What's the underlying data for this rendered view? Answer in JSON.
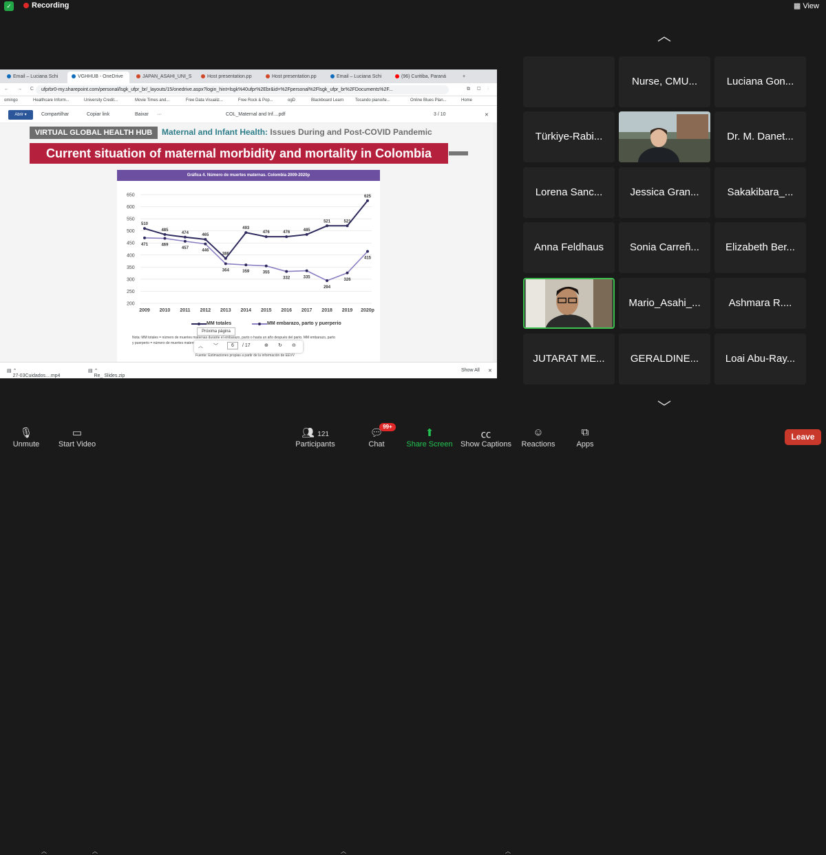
{
  "topbar": {
    "recording": "Recording",
    "view": "View"
  },
  "browser": {
    "tabs": [
      {
        "label": "Email – Luciana Schi",
        "color": "#0f6cbd"
      },
      {
        "label": "VGHHUB - OneDrive",
        "color": "#0f6cbd"
      },
      {
        "label": "JAPAN_ASAHI_UNI_S",
        "color": "#d24726"
      },
      {
        "label": "Host presentation.pp",
        "color": "#d24726"
      },
      {
        "label": "Host presentation.pp",
        "color": "#d24726"
      },
      {
        "label": "Email – Luciana Schi",
        "color": "#0f6cbd"
      },
      {
        "label": "(96) Curitiba, Paraná",
        "color": "#ff0000"
      }
    ],
    "url": "ufprbr0-my.sharepoint.com/personal/lsgk_ufpr_br/_layouts/15/onedrive.aspx?login_hint=lsgk%40ufpr%2Ebr&id=%2Fpersonal%2Flsgk_ufpr_br%2FDocuments%2F...",
    "bookmarks": [
      "omingo",
      "Healthcare Inform...",
      "University Credit...",
      "Movie Times and...",
      "Free Data Visualiz...",
      "Free Rock & Pop...",
      "ogD",
      "Blackboard Learn",
      "Tocando piano/te...",
      "Online Blues Plan...",
      "Home"
    ]
  },
  "pdfbar": {
    "abrir": "Abrir ▾",
    "compartilhar": "Compartilhar",
    "copiar": "Copiar link",
    "baixar": "Baixar",
    "more": "···",
    "filename": "COL_Maternal and Inf....pdf",
    "page": "3 / 10"
  },
  "slide": {
    "hub": "VIRTUAL GLOBAL HEALTH HUB",
    "topic_main": "Maternal and Infant Health:",
    "topic_rest": " Issues During and Post-COVID Pandemic",
    "banner": "Current situation of maternal morbidity and mortality in Colombia",
    "chart_title": "Gráfica 4. Número de muertes maternas. Colombia 2009-2020p",
    "note1": "Nota: MM totales = número de muertes maternas durante el embarazo, parto o hasta un año después del parto. MM embarazo, parto",
    "note2": "y puerperio = número de muertes maternas ... después del parto",
    "fuente": "Fuente: Estimaciones propias a partir de la información de EEVV",
    "tooltip": "Próxima página",
    "page_current": "6",
    "page_total": "/ 17"
  },
  "chart_data": {
    "type": "line",
    "title": "Gráfica 4. Número de muertes maternas. Colombia 2009-2020p",
    "x": [
      "2009",
      "2010",
      "2011",
      "2012",
      "2013",
      "2014",
      "2015",
      "2016",
      "2017",
      "2018",
      "2019",
      "2020p"
    ],
    "series": [
      {
        "name": "MM totales",
        "values": [
          510,
          485,
          474,
          465,
          386,
          493,
          476,
          476,
          485,
          521,
          521,
          625
        ]
      },
      {
        "name": "MM embarazo, parto y puerperio",
        "values": [
          471,
          469,
          457,
          446,
          364,
          359,
          355,
          332,
          335,
          294,
          326,
          415
        ]
      }
    ],
    "ylim": [
      200,
      650
    ],
    "yticks": [
      200,
      250,
      300,
      350,
      400,
      450,
      500,
      550,
      600,
      650
    ],
    "colors": {
      "totales": "#2e2a5e",
      "embarazo": "#8b80c4"
    }
  },
  "downloads": {
    "file1": "27-03Cuidados....mp4",
    "file2": "Re_ Slides.zip",
    "showall": "Show All"
  },
  "participants_grid": [
    {
      "name": ""
    },
    {
      "name": "Nurse, CMU..."
    },
    {
      "name": "Luciana Gon..."
    },
    {
      "name": "Türkiye-Rabi..."
    },
    {
      "name": ""
    },
    {
      "name": "Dr. M. Danet..."
    },
    {
      "name": "Lorena Sanc..."
    },
    {
      "name": "Jessica Gran..."
    },
    {
      "name": "Sakakibara_..."
    },
    {
      "name": "Anna Feldhaus"
    },
    {
      "name": "Sonia Carreñ..."
    },
    {
      "name": "Elizabeth Ber..."
    },
    {
      "name": ""
    },
    {
      "name": "Mario_Asahi_..."
    },
    {
      "name": "Ashmara R...."
    },
    {
      "name": "JUTARAT ME..."
    },
    {
      "name": "GERALDINE..."
    },
    {
      "name": "Loai Abu-Ray..."
    }
  ],
  "toolbar": {
    "unmute": "Unmute",
    "start_video": "Start Video",
    "participants": "Participants",
    "participant_count": "121",
    "chat": "Chat",
    "chat_badge": "99+",
    "share_screen": "Share Screen",
    "captions": "Show Captions",
    "reactions": "Reactions",
    "apps": "Apps",
    "leave": "Leave"
  }
}
